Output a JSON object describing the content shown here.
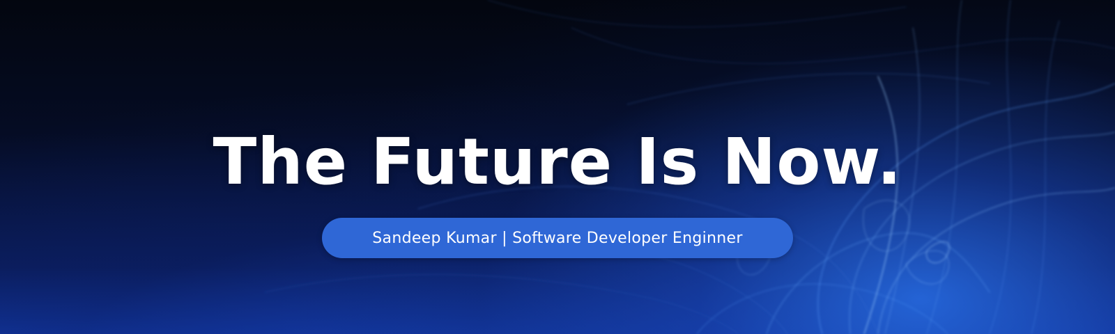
{
  "banner": {
    "headline": "The Future Is Now.",
    "subtitle": "Sandeep Kumar | Software Developer Enginner"
  },
  "colors": {
    "background_dark": "#050a1a",
    "background_blue": "#1236a0",
    "pill": "#2f67d6",
    "text": "#ffffff"
  }
}
